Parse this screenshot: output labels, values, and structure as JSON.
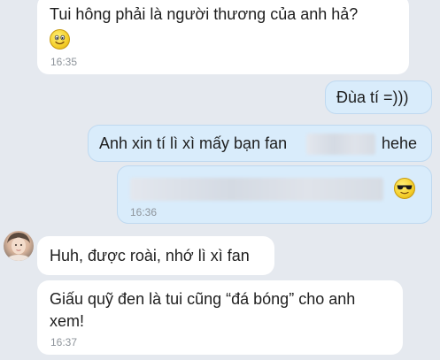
{
  "messages": [
    {
      "text": "Tui hông phải là người thương của anh hả?",
      "time": "16:35",
      "emoji": "smiley-emoji"
    },
    {
      "text": "Đùa tí =)))"
    },
    {
      "text_start": "Anh xin tí lì xì mấy bạn fan",
      "text_end": "hehe"
    },
    {
      "time": "16:36",
      "emoji": "sunglasses-emoji"
    },
    {
      "text": "Huh, được roài, nhớ lì xì fan"
    },
    {
      "line1": "Giấu quỹ đen là tui cũng “đá bóng” cho anh",
      "line2": "xem!",
      "time": "16:37"
    }
  ],
  "colors": {
    "background": "#e5e9ef",
    "incoming": "#ffffff",
    "outgoing": "#d9ecfb"
  }
}
